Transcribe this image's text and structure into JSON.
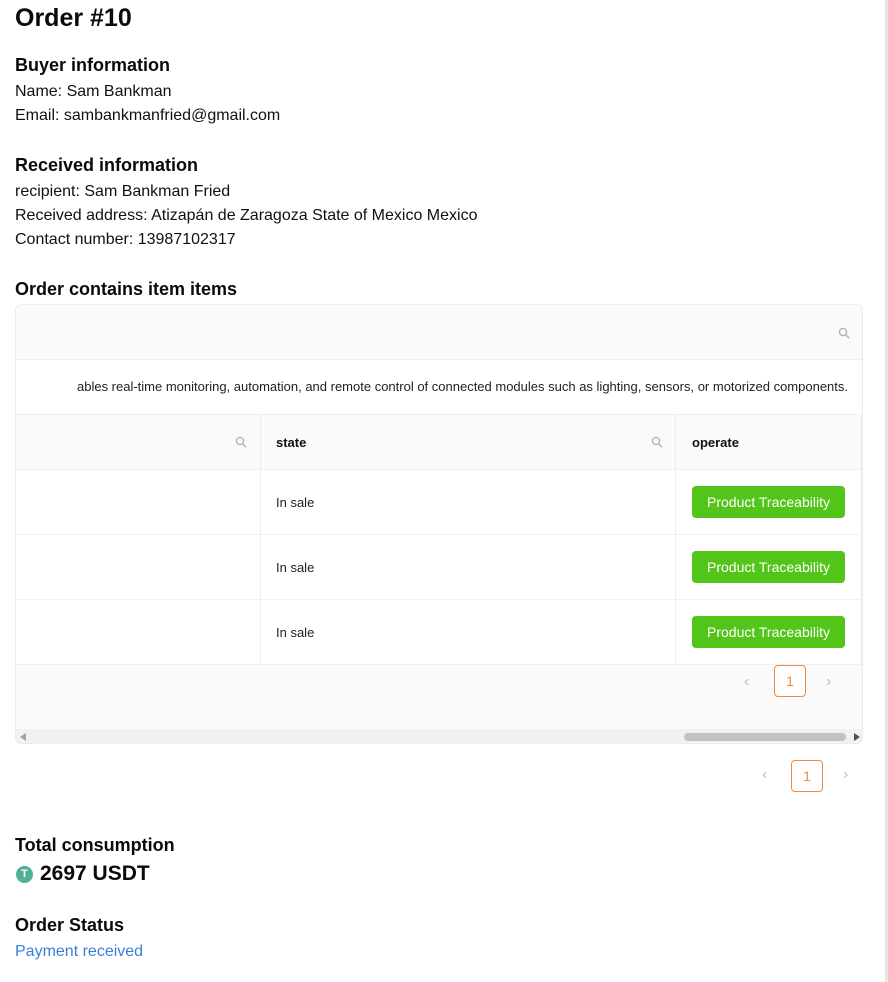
{
  "order": {
    "title": "Order #10"
  },
  "buyer": {
    "heading": "Buyer information",
    "name_line": "Name: Sam Bankman",
    "email_line": "Email: sambankmanfried@gmail.com"
  },
  "received": {
    "heading": "Received information",
    "recipient_line": "recipient: Sam Bankman Fried",
    "address_line": "Received address: Atizapán de Zaragoza State of Mexico Mexico",
    "contact_line": "Contact number: 13987102317"
  },
  "items_section": {
    "heading": "Order contains item items",
    "description_fragment": "ables real-time monitoring, automation, and remote control of connected modules such as lighting, sensors, or motorized components.",
    "columns": {
      "state": "state",
      "operate": "operate"
    },
    "rows": [
      {
        "state": "In sale",
        "action": "Product Traceability"
      },
      {
        "state": "In sale",
        "action": "Product Traceability"
      },
      {
        "state": "In sale",
        "action": "Product Traceability"
      }
    ],
    "inner_pagination": {
      "current": "1"
    },
    "outer_pagination": {
      "current": "1"
    }
  },
  "total": {
    "heading": "Total consumption",
    "amount": "2697 USDT",
    "currency_icon": "T"
  },
  "status": {
    "heading": "Order Status",
    "value": "Payment received"
  },
  "colors": {
    "accent_green": "#52c41a",
    "pagination_orange": "#f08a3c",
    "status_blue": "#3b7ddd",
    "usdt_green": "#50af95"
  }
}
